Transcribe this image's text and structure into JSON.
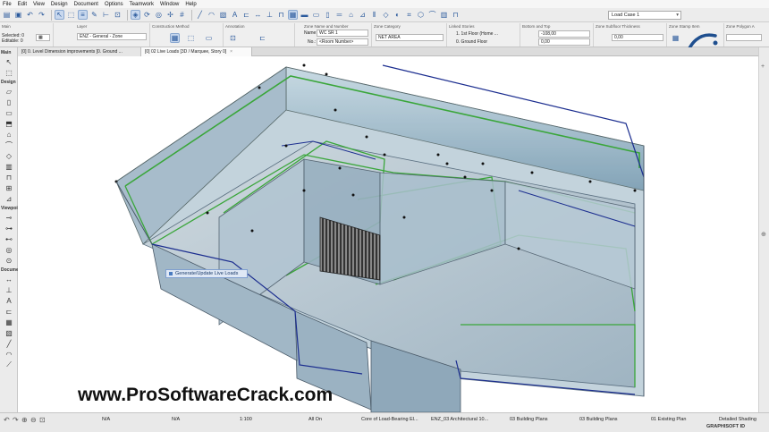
{
  "menu": [
    "File",
    "Edit",
    "View",
    "Design",
    "Document",
    "Options",
    "Teamwork",
    "Window",
    "Help"
  ],
  "toolbar": {
    "load_case": "Load Case 1"
  },
  "infobox": {
    "main_title": "Main",
    "selected": "Selected: 0",
    "editable": "Editable: 0",
    "layer_title": "Layer",
    "layer_value": "ENZ - General - Zone",
    "construction_title": "Construction Method",
    "annotation_title": "Annotation",
    "zone_name_title": "Zone Name and Number",
    "name_label": "Name:",
    "name_value": "WC SR 1",
    "no_label": "No.:",
    "no_value": "<Room Number>",
    "category_title": "Zone Category",
    "category_value": "NET AREA",
    "stories_title": "Linked Stories",
    "story_1": "1. 1st Floor (Home ...",
    "story_0": "0. Ground Floor",
    "bottom_top_title": "Bottom and Top",
    "top_value": "-108,00",
    "bottom_value": "0,00",
    "subfloor_title": "Zone Subfloor Thickness",
    "subfloor_value": "0,00",
    "stamp_title": "Zone Stamp Item",
    "polygon_title": "Zone Polygon A"
  },
  "toolbox": {
    "main_label": "Main",
    "design_label": "Design",
    "viewpoint_label": "Viewpoi",
    "document_label": "Docume"
  },
  "tabs": [
    {
      "label": "[0] 0. Level Dimension improvements [0. Ground ..."
    },
    {
      "label": "[0] 02 Live Loads [3D / Marquee, Story 0]"
    }
  ],
  "popup": "Generate/Update Live Loads",
  "watermark": "www.ProSoftwareCrack.com",
  "status": {
    "na_1": "N/A",
    "na_2": "N/A",
    "scale": "1:100",
    "layers": "All On",
    "model_view": "Core of Load-Bearing El...",
    "pen_set": "ENZ_03 Architectural 10...",
    "override": "03 Building Plans",
    "renovation": "03 Building Plans",
    "filter": "01 Existing Plan",
    "shading": "Detailed Shading",
    "brand": "GRAPHISOFT ID"
  },
  "colors": {
    "accent": "#1f4f8f",
    "green_zone": "#3aa63a",
    "glass": "#8fb4c8"
  }
}
